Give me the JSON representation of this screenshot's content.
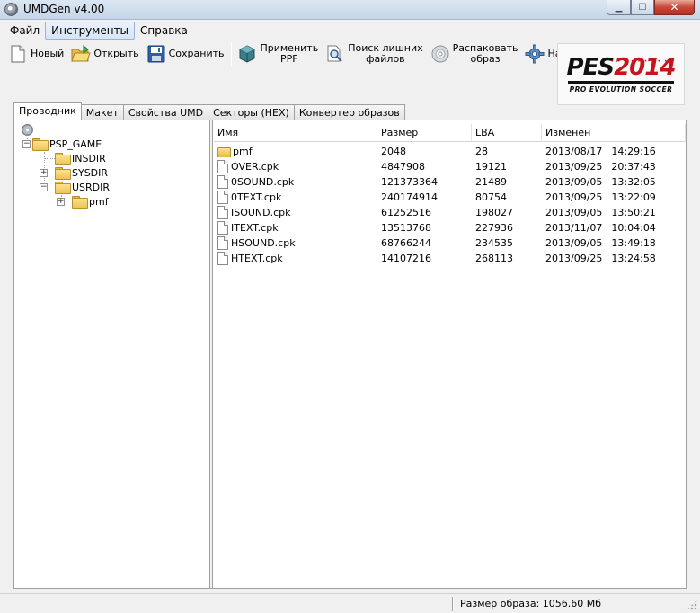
{
  "window": {
    "title": "UMDGen v4.00"
  },
  "menu": [
    {
      "label": "Файл"
    },
    {
      "label": "Инструменты"
    },
    {
      "label": "Справка"
    }
  ],
  "toolbar": {
    "new_label": "Новый",
    "open_label": "Открыть",
    "save_label": "Сохранить",
    "apply_ppf_line1": "Применить",
    "apply_ppf_line2": "PPF",
    "find_extra_line1": "Поиск лишних",
    "find_extra_line2": "файлов",
    "unpack_line1": "Распаковать",
    "unpack_line2": "образ",
    "settings_label": "Настройки"
  },
  "logo": {
    "main": "PES",
    "year": "2014",
    "subtitle": "PRO EVOLUTION SOCCER"
  },
  "tabs": [
    {
      "label": "Проводник"
    },
    {
      "label": "Макет"
    },
    {
      "label": "Свойства UMD"
    },
    {
      "label": "Секторы (HEX)"
    },
    {
      "label": "Конвертер образов"
    }
  ],
  "tree": {
    "root": "PSP_GAME",
    "children": [
      "INSDIR",
      "SYSDIR",
      "USRDIR"
    ],
    "usrdir_child": "pmf",
    "expand_minus": "−",
    "expand_plus": "+"
  },
  "list": {
    "columns": [
      "Имя",
      "Размер",
      "LBA",
      "Изменен"
    ],
    "rows": [
      {
        "name": "pmf",
        "size": "2048",
        "lba": "28",
        "date": "2013/08/17",
        "time": "14:29:16",
        "type": "folder"
      },
      {
        "name": "OVER.cpk",
        "size": "4847908",
        "lba": "19121",
        "date": "2013/09/25",
        "time": "20:37:43",
        "type": "file"
      },
      {
        "name": "0SOUND.cpk",
        "size": "121373364",
        "lba": "21489",
        "date": "2013/09/05",
        "time": "13:32:05",
        "type": "file"
      },
      {
        "name": "0TEXT.cpk",
        "size": "240174914",
        "lba": "80754",
        "date": "2013/09/25",
        "time": "13:22:09",
        "type": "file"
      },
      {
        "name": "ISOUND.cpk",
        "size": "61252516",
        "lba": "198027",
        "date": "2013/09/05",
        "time": "13:50:21",
        "type": "file"
      },
      {
        "name": "ITEXT.cpk",
        "size": "13513768",
        "lba": "227936",
        "date": "2013/11/07",
        "time": "10:04:04",
        "type": "file"
      },
      {
        "name": "HSOUND.cpk",
        "size": "68766244",
        "lba": "234535",
        "date": "2013/09/05",
        "time": "13:49:18",
        "type": "file"
      },
      {
        "name": "HTEXT.cpk",
        "size": "14107216",
        "lba": "268113",
        "date": "2013/09/25",
        "time": "13:24:58",
        "type": "file"
      }
    ]
  },
  "status": {
    "image_size": "Размер образа: 1056.60 Мб"
  }
}
